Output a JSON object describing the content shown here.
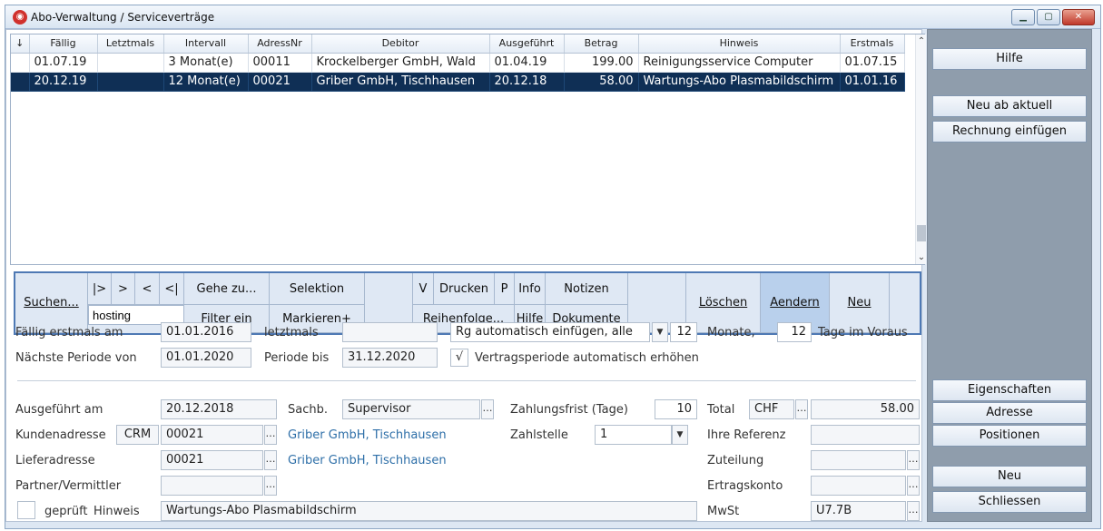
{
  "window": {
    "title": "Abo-Verwaltung / Serviceverträge",
    "app_icon": "app-logo-icon"
  },
  "grid": {
    "columns": [
      "Fällig",
      "Letztmals",
      "Intervall",
      "AdressNr",
      "Debitor",
      "Ausgeführt",
      "Betrag",
      "Hinweis",
      "Erstmals"
    ],
    "rows": [
      {
        "faellig": "01.07.19",
        "letztmals": "",
        "intervall": "3 Monat(e)",
        "adressnr": "00011",
        "debitor": "Krockelberger GmbH, Wald",
        "ausgefuehrt": "01.04.19",
        "betrag": "199.00",
        "hinweis": "Reinigungsservice Computer",
        "erstmals": "01.07.15"
      },
      {
        "faellig": "20.12.19",
        "letztmals": "",
        "intervall": "12 Monat(e)",
        "adressnr": "00021",
        "debitor": "Griber GmbH, Tischhausen",
        "ausgefuehrt": "20.12.18",
        "betrag": "58.00",
        "hinweis": "Wartungs-Abo Plasmabildschirm",
        "erstmals": "01.01.16"
      }
    ]
  },
  "toolbar": {
    "suchen": "Suchen...",
    "first": "|>",
    "next": ">",
    "prev": "<",
    "last": "<|",
    "search_value": "hosting",
    "gehe_zu": "Gehe zu...",
    "filter_ein": "Filter ein",
    "selektion": "Selektion",
    "markieren": "Markieren+",
    "v": "V",
    "drucken": "Drucken",
    "p": "P",
    "info": "Info",
    "notizen": "Notizen",
    "reihenfolge": "Reihenfolge...",
    "hilfe": "Hilfe",
    "dokumente": "Dokumente",
    "loeschen": "Löschen",
    "aendern": "Aendern",
    "neu": "Neu"
  },
  "period": {
    "faellig_label": "Fällig erstmals am",
    "faellig_value": "01.01.2016",
    "letztmals_label": "letztmals",
    "letztmals_value": "",
    "rg_option": "Rg automatisch einfügen, alle",
    "monate_value": "12",
    "monate_label": "Monate,",
    "tage_value": "12",
    "tage_label": "Tage im Voraus",
    "naechste_label": "Nächste Periode von",
    "naechste_value": "01.01.2020",
    "bis_label": "Periode bis",
    "bis_value": "31.12.2020",
    "auto_check": "√",
    "auto_label": "Vertragsperiode automatisch erhöhen"
  },
  "details": {
    "ausgefuehrt_label": "Ausgeführt am",
    "ausgefuehrt_value": "20.12.2018",
    "sachb_label": "Sachb.",
    "sachb_value": "Supervisor",
    "zahlungsfrist_label": "Zahlungsfrist (Tage)",
    "zahlungsfrist_value": "10",
    "total_label": "Total",
    "currency": "CHF",
    "total_value": "58.00",
    "kunden_label": "Kundenadresse",
    "crm": "CRM",
    "kunden_nr": "00021",
    "kunden_name": "Griber GmbH, Tischhausen",
    "zahlstelle_label": "Zahlstelle",
    "zahlstelle_value": "1",
    "referenz_label": "Ihre Referenz",
    "referenz_value": "",
    "liefer_label": "Lieferadresse",
    "liefer_nr": "00021",
    "liefer_name": "Griber GmbH, Tischhausen",
    "zuteilung_label": "Zuteilung",
    "zuteilung_value": "",
    "partner_label": "Partner/Vermittler",
    "partner_value": "",
    "ertrag_label": "Ertragskonto",
    "ertrag_value": "",
    "geprueft_label": "geprüft",
    "hinweis_label": "Hinweis",
    "hinweis_value": "Wartungs-Abo Plasmabildschirm",
    "mwst_label": "MwSt",
    "mwst_value": "U7.7B"
  },
  "sidebar": {
    "hilfe": "Hilfe",
    "neu_ab_aktuell": "Neu ab aktuell",
    "rechnung_einfuegen": "Rechnung einfügen",
    "eigenschaften": "Eigenschaften",
    "adresse": "Adresse",
    "positionen": "Positionen",
    "neu": "Neu",
    "schliessen": "Schliessen"
  },
  "colors": {
    "selection": "#0f2f55",
    "accent": "#4e79b4",
    "link": "#2e6fa8",
    "sidebar": "#8f9dac"
  }
}
